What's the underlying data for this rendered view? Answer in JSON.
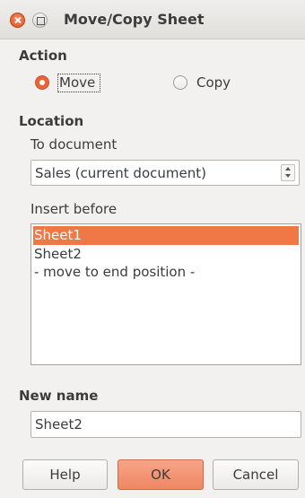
{
  "window": {
    "title": "Move/Copy Sheet"
  },
  "action": {
    "heading": "Action",
    "move_label": "Move",
    "copy_label": "Copy",
    "selected": "Move"
  },
  "location": {
    "heading": "Location",
    "to_document_label": "To document",
    "to_document_value": "Sales (current document)",
    "insert_before_label": "Insert before",
    "insert_before_items": [
      "Sheet1",
      "Sheet2",
      "- move to end position -"
    ],
    "selected_item": "Sheet1"
  },
  "new_name": {
    "heading": "New name",
    "value": "Sheet2"
  },
  "buttons": {
    "help": "Help",
    "ok": "OK",
    "cancel": "Cancel"
  },
  "colors": {
    "accent": "#f07746",
    "primary_button": "#f08762"
  }
}
